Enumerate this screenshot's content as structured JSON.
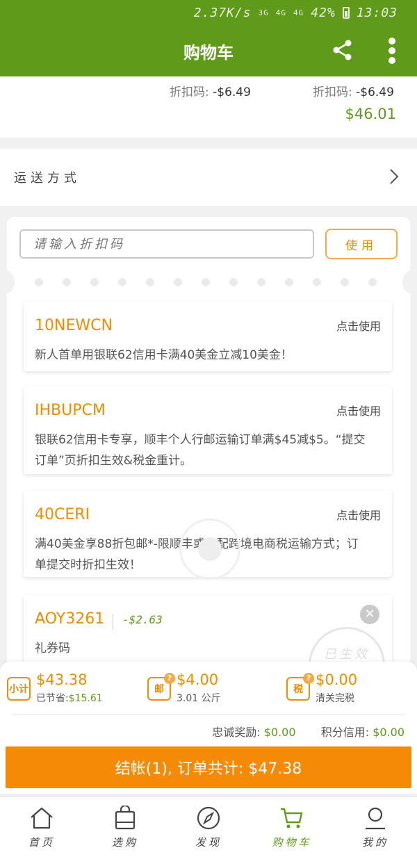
{
  "status_bar": {
    "speed": "2.37K/s",
    "network_3g": "3G",
    "network_4g": "4G",
    "network_4g2": "4G",
    "battery": "42%",
    "time": "13:03"
  },
  "header": {
    "title": "购物车"
  },
  "order_top": {
    "discount_label": "折扣码:",
    "discount1": "-$6.49",
    "discount2": "-$6.49",
    "total": "$46.01"
  },
  "shipping": {
    "label": "运送方式"
  },
  "coupon_area": {
    "placeholder": "请输入折扣码",
    "use_button": "使用",
    "coupons": [
      {
        "code": "10NEWCN",
        "action": "点击使用",
        "desc": "新人首单用银联62信用卡满40美金立减10美金！"
      },
      {
        "code": "IHBUPCM",
        "action": "点击使用",
        "desc": "银联62信用卡专享，顺丰个人行邮运输订单满$45减$5。“提交订单”页折扣生效&税金重计。"
      },
      {
        "code": "40CERI",
        "action": "点击使用",
        "desc": "满40美金享88折包邮*-限顺丰或京配跨境电商税运输方式；订单提交时折扣生效！"
      },
      {
        "code": "AOY3261",
        "value": "-$2.63",
        "desc": "礼券码",
        "stamp": "已生效"
      }
    ]
  },
  "summary": {
    "subtotal": {
      "badge": "小计",
      "amount": "$43.38",
      "saved_label": "已节省:",
      "saved": "$15.61"
    },
    "postage": {
      "badge": "邮",
      "amount": "$4.00",
      "weight": "3.01 公斤"
    },
    "tax": {
      "badge": "税",
      "amount": "$0.00",
      "note": "清关完税"
    },
    "loyalty_label": "忠诚奖励:",
    "loyalty_value": "$0.00",
    "credit_label": "积分信用:",
    "credit_value": "$0.00"
  },
  "checkout": {
    "label": "结帐(1), 订单共计: $47.38"
  },
  "tabs": [
    {
      "label": "首页",
      "icon": "home-icon"
    },
    {
      "label": "选购",
      "icon": "shopping-bag-icon"
    },
    {
      "label": "发现",
      "icon": "compass-icon"
    },
    {
      "label": "购物车",
      "icon": "cart-icon"
    },
    {
      "label": "我的",
      "icon": "user-icon"
    }
  ],
  "colors": {
    "brand_green": "#5f9a1a",
    "accent_orange": "#f08c00",
    "checkout_orange": "#f58a07"
  }
}
